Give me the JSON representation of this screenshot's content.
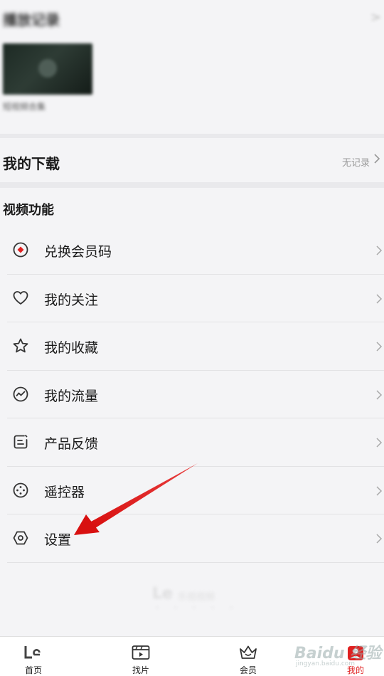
{
  "history": {
    "title": "播放记录",
    "more": ">",
    "thumb_caption": "短视频合集"
  },
  "download": {
    "title": "我的下载",
    "status": "无记录"
  },
  "video_features": {
    "title": "视频功能",
    "items": [
      {
        "label": "兑换会员码",
        "icon": "redeem-icon"
      },
      {
        "label": "我的关注",
        "icon": "heart-icon"
      },
      {
        "label": "我的收藏",
        "icon": "star-icon"
      },
      {
        "label": "我的流量",
        "icon": "traffic-icon"
      },
      {
        "label": "产品反馈",
        "icon": "feedback-icon"
      },
      {
        "label": "遥控器",
        "icon": "remote-icon"
      },
      {
        "label": "设置",
        "icon": "settings-icon"
      }
    ]
  },
  "footer": {
    "logo_main": "Le",
    "logo_sub": "乐视视频",
    "logo_dots": "• • • • •"
  },
  "tabbar": {
    "tabs": [
      {
        "label": "首页",
        "icon": "le-logo-icon",
        "active": false
      },
      {
        "label": "找片",
        "icon": "clapperboard-icon",
        "active": false
      },
      {
        "label": "会员",
        "icon": "crown-icon",
        "active": false
      },
      {
        "label": "我的",
        "icon": "profile-icon",
        "active": true
      }
    ]
  },
  "watermark": {
    "main": "Baidu 经验",
    "sub": "jingyan.baidu.com"
  },
  "colors": {
    "accent": "#e02020",
    "background": "#f4f4f6",
    "annotation_arrow": "#e01818"
  }
}
